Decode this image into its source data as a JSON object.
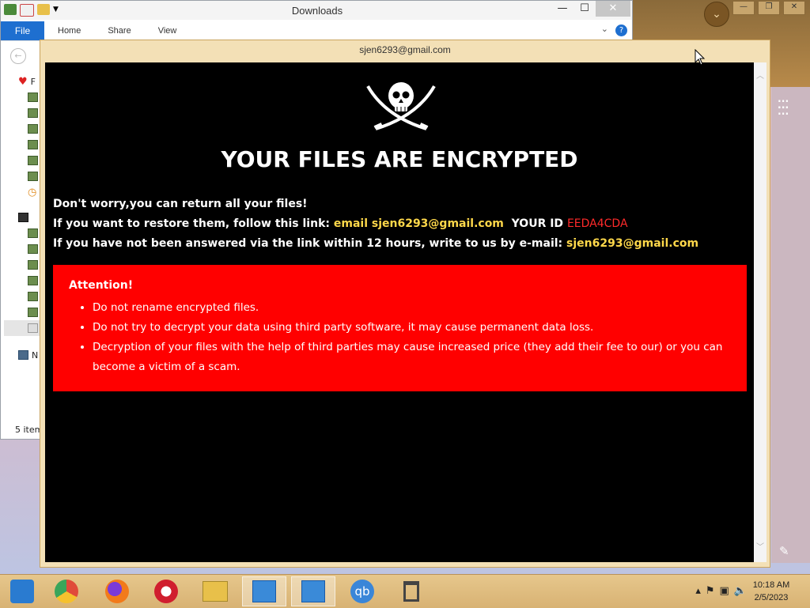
{
  "explorer": {
    "title": "Downloads",
    "ribbon": {
      "file_tab": "File",
      "tabs": [
        "Home",
        "Share",
        "View"
      ],
      "help": "?"
    },
    "sidebar_letters": {
      "favorites": "F",
      "network": "N"
    },
    "status": "5 item"
  },
  "note_window": {
    "title": "sjen6293@gmail.com",
    "headline": "YOUR FILES ARE ENCRYPTED",
    "line1": "Don't worry,you can return all your files!",
    "line2_prefix": "If you want to restore them, follow this link:",
    "line2_link": "email sjen6293@gmail.com",
    "line2_id_label": "YOUR ID",
    "line2_id": "EEDA4CDA",
    "line3_prefix": "If you have not been answered via the link within 12 hours, write to us by e-mail:",
    "line3_email": "sjen6293@gmail.com",
    "attention": {
      "title": "Attention!",
      "items": [
        "Do not rename encrypted files.",
        "Do not try to decrypt your data using third party software, it may cause permanent data loss.",
        "Decryption of your files with the help of third parties may cause increased price (they add their fee to our) or you can become a victim of a scam."
      ]
    }
  },
  "taskbar": {
    "apps": [
      {
        "name": "computer-icon",
        "color": "#2a7bd0"
      },
      {
        "name": "chrome-icon",
        "color": "#e04a3a"
      },
      {
        "name": "firefox-icon",
        "color": "#f27a1a"
      },
      {
        "name": "opera-icon",
        "color": "#d01e2e"
      },
      {
        "name": "file-explorer-icon",
        "color": "#e8c04a"
      },
      {
        "name": "network-app-icon",
        "color": "#3a8ad8"
      },
      {
        "name": "network-app-icon-2",
        "color": "#3a8ad8"
      },
      {
        "name": "qbittorrent-icon",
        "color": "#3a86d8"
      },
      {
        "name": "recycle-bin-icon",
        "color": "#555555"
      }
    ],
    "qb_label": "qb",
    "time": "10:18 AM",
    "date": "2/5/2023"
  },
  "colors": {
    "alert_red": "#ff0000",
    "link_yellow": "#ffd84a",
    "id_red": "#ff2a2a"
  }
}
